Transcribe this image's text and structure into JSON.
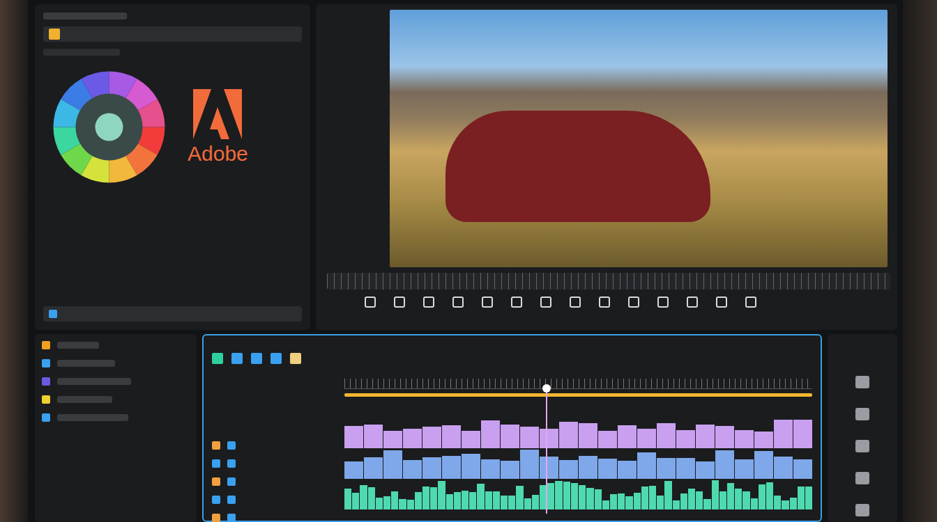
{
  "logo": {
    "text": "Adobe"
  },
  "layers": [
    {
      "color": "#f0a020"
    },
    {
      "color": "#3aa0f0"
    },
    {
      "color": "#6a5ae0"
    },
    {
      "color": "#f0d030"
    },
    {
      "color": "#3aa0f0"
    }
  ],
  "timeline": {
    "playhead": {
      "level": 0.43
    },
    "tracks": [
      {
        "kind": "video",
        "color": "#c9a0f0"
      },
      {
        "kind": "video",
        "color": "#7fa8ea"
      },
      {
        "kind": "audio",
        "color": "#4fd9b0"
      }
    ]
  }
}
